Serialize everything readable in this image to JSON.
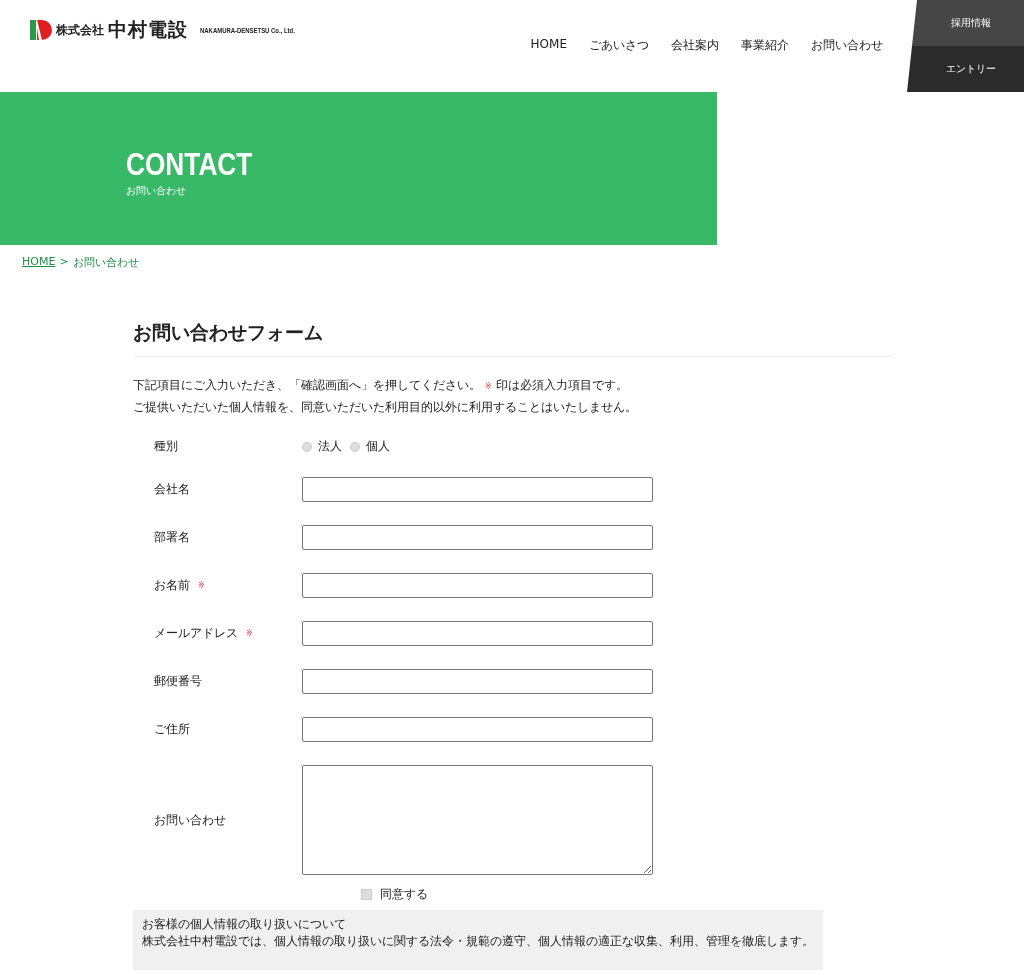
{
  "header": {
    "logo_text": "株式会社",
    "logo_name": "中村電設",
    "logo_en": "NAKAMURA-DENSETSU Co., Ltd.",
    "nav": [
      "HOME",
      "ごあいさつ",
      "会社案内",
      "事業紹介",
      "お問い合わせ"
    ],
    "side_buttons": [
      "採用情報",
      "エントリー"
    ]
  },
  "banner": {
    "title": "CONTACT",
    "subtitle": "お問い合わせ"
  },
  "breadcrumb": [
    {
      "label": "HOME",
      "link": true
    },
    {
      "label": ">",
      "link": false
    },
    {
      "label": "お問い合わせ",
      "link": false
    }
  ],
  "form": {
    "title": "お問い合わせフォーム",
    "intro": [
      {
        "before": "下記項目にご入力いただき、「確認画面へ」を押してください。",
        "mark": "※",
        "after": "印は必須入力項目です。"
      },
      {
        "before": "ご提供いただいた個人情報を、同意いただいた利用目的以外に利用することはいたしません。"
      }
    ],
    "fields": [
      {
        "kind": "radio",
        "label": "種別",
        "options": [
          {
            "label": "法人",
            "selected": false
          },
          {
            "label": "個人",
            "selected": false
          }
        ]
      },
      {
        "kind": "text",
        "label": "会社名"
      },
      {
        "kind": "text",
        "label": "部署名"
      },
      {
        "kind": "text",
        "label": "お名前",
        "required_mark": "※"
      },
      {
        "kind": "text",
        "label": "メールアドレス",
        "required_mark": "※"
      },
      {
        "kind": "text",
        "label": "郵便番号"
      },
      {
        "kind": "text",
        "label": "ご住所"
      },
      {
        "kind": "textarea",
        "label": "お問い合わせ"
      }
    ],
    "agree": {
      "label": "同意する",
      "checked": false
    },
    "privacy": {
      "title": "お客様の個人情報の取り扱いについて",
      "body": "株式会社中村電設では、個人情報の取り扱いに関する法令・規範の遵守、個人情報の適正な収集、利用、管理を徹底します。"
    }
  }
}
